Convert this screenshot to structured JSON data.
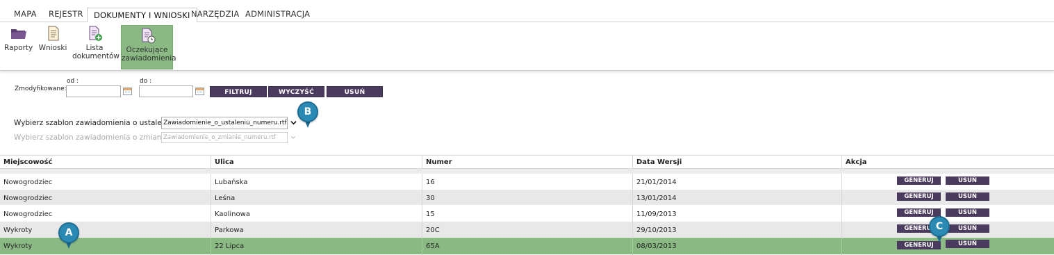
{
  "tabs": [
    {
      "label": "MAPA"
    },
    {
      "label": "REJESTR"
    },
    {
      "label": "DOKUMENTY I WNIOSKI"
    },
    {
      "label": "NARZĘDZIA"
    },
    {
      "label": "ADMINISTRACJA"
    }
  ],
  "active_tab": "DOKUMENTY I WNIOSKI",
  "toolbar": {
    "items": [
      {
        "label": "Raporty",
        "icon": "folder-icon"
      },
      {
        "label": "Wnioski",
        "icon": "document-icon"
      },
      {
        "label_line1": "Lista",
        "label_line2": "dokumentów",
        "icon": "document-add-icon"
      },
      {
        "label_line1": "Oczekujące",
        "label_line2": "zawiadomienia",
        "icon": "document-clock-icon"
      }
    ]
  },
  "filter": {
    "modified_label": "Zmodyfikowane:",
    "from_label": "od :",
    "to_label": "do :",
    "from_value": "",
    "to_value": "",
    "filter_button": "FILTRUJ",
    "clear_button": "WYCZYŚĆ",
    "delete_button": "USUŃ"
  },
  "templates": {
    "established_label": "Wybierz szablon zawiadomienia o ustaleniu",
    "established_value": "Zawiadomienie_o_ustaleniu_numeru.rtf",
    "change_label": "Wybierz szablon zawiadomienia o zmianie",
    "change_value": "Zawiadomienie_o_zmianie_numeru.rtf",
    "required_mark": "*",
    "colon": ":"
  },
  "table": {
    "columns": [
      "Miejscowość",
      "Ulica",
      "Numer",
      "Data Wersji",
      "Akcja"
    ],
    "rows": [
      {
        "miejscowosc": "Nowogrodziec",
        "ulica": "Lubańska",
        "numer": "16",
        "data": "21/01/2014"
      },
      {
        "miejscowosc": "Nowogrodziec",
        "ulica": "Leśna",
        "numer": "30",
        "data": "13/01/2014"
      },
      {
        "miejscowosc": "Nowogrodziec",
        "ulica": "Kaolinowa",
        "numer": "15",
        "data": "11/09/2013"
      },
      {
        "miejscowosc": "Wykroty",
        "ulica": "Parkowa",
        "numer": "20C",
        "data": "29/10/2013"
      },
      {
        "miejscowosc": "Wykroty",
        "ulica": "22 Lipca",
        "numer": "65A",
        "data": "08/03/2013"
      }
    ],
    "generate_label": "GENERUJ",
    "delete_label": "USUŃ",
    "selected_row": 4
  },
  "markers": {
    "a": "A",
    "b": "B",
    "c": "C"
  },
  "colors": {
    "accent_green": "#8ab984",
    "button_purple": "#4a3a5e",
    "marker_blue": "#2a8ab4",
    "required_red": "#d23a3a"
  }
}
